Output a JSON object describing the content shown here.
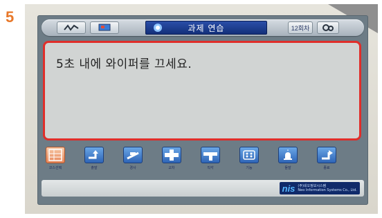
{
  "step_number": "5",
  "toolbar": {
    "title": "과제 연습",
    "count_label": "12회차",
    "buttons": [
      {
        "icon": "signal-wave-icon"
      },
      {
        "icon": "monitor-icon"
      },
      {
        "icon": "settings-gears-icon"
      }
    ]
  },
  "message": {
    "text": "5초 내에 와이퍼를 끄세요."
  },
  "icon_bar": {
    "items": [
      {
        "icon": "map-grid-icon",
        "label": "코스선택"
      },
      {
        "icon": "turn-right-icon",
        "label": "출발"
      },
      {
        "icon": "car-icon",
        "label": "경사"
      },
      {
        "icon": "crossroad-icon",
        "label": "교차"
      },
      {
        "icon": "t-junction-icon",
        "label": "직각"
      },
      {
        "icon": "dashboard-icon",
        "label": "기능"
      },
      {
        "icon": "emergency-light-icon",
        "label": "돌발"
      },
      {
        "icon": "finish-icon",
        "label": "종료"
      }
    ]
  },
  "footer": {
    "logo_main": "nis",
    "logo_sub_1": "(주)네오정보시스템",
    "logo_sub_2": "Neo Information Systems Co., Ltd."
  },
  "colors": {
    "highlight_border": "#e02e2a",
    "title_bg": "#1a3b8f",
    "step_number": "#e8782a"
  }
}
